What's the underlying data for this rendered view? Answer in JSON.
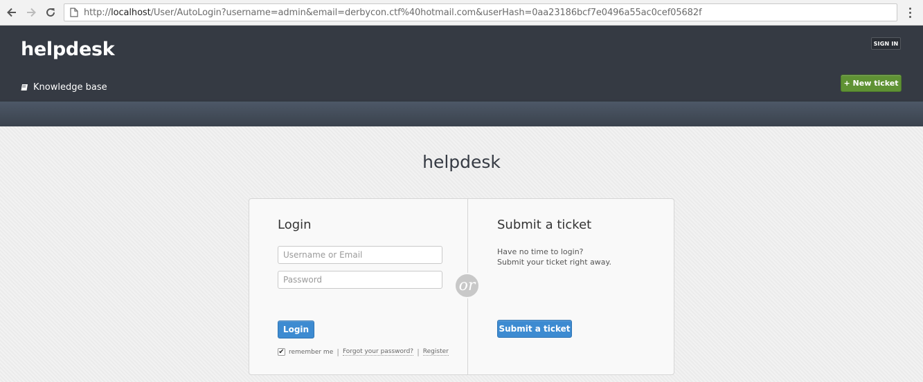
{
  "browser": {
    "url_prefix": "http://",
    "url_host": "localhost",
    "url_path": "/User/AutoLogin?username=admin&email=derbycon.ctf%40hotmail.com&userHash=0aa23186bcf7e0496a55ac0cef05682f",
    "icons": [
      "back-icon",
      "forward-icon",
      "reload-icon",
      "page-icon",
      "menu-icon"
    ]
  },
  "header": {
    "brand": "helpdesk",
    "signin_label": "SIGN IN",
    "kb_label": "Knowledge base",
    "new_ticket_label": "+ New ticket"
  },
  "main": {
    "page_title": "helpdesk",
    "login": {
      "title": "Login",
      "username_placeholder": "Username or Email",
      "password_placeholder": "Password",
      "button_label": "Login",
      "remember_label": "remember me",
      "remember_checked": true,
      "forgot_label": "Forgot your password?",
      "register_label": "Register",
      "separator": "|"
    },
    "or_label": "or",
    "submit": {
      "title": "Submit a ticket",
      "line1": "Have no time to login?",
      "line2": "Submit your ticket right away.",
      "button_label": "Submit a ticket"
    }
  },
  "colors": {
    "header_bg": "#353a43",
    "new_ticket_green": "#5f9234",
    "primary_blue": "#3d8bd1"
  }
}
